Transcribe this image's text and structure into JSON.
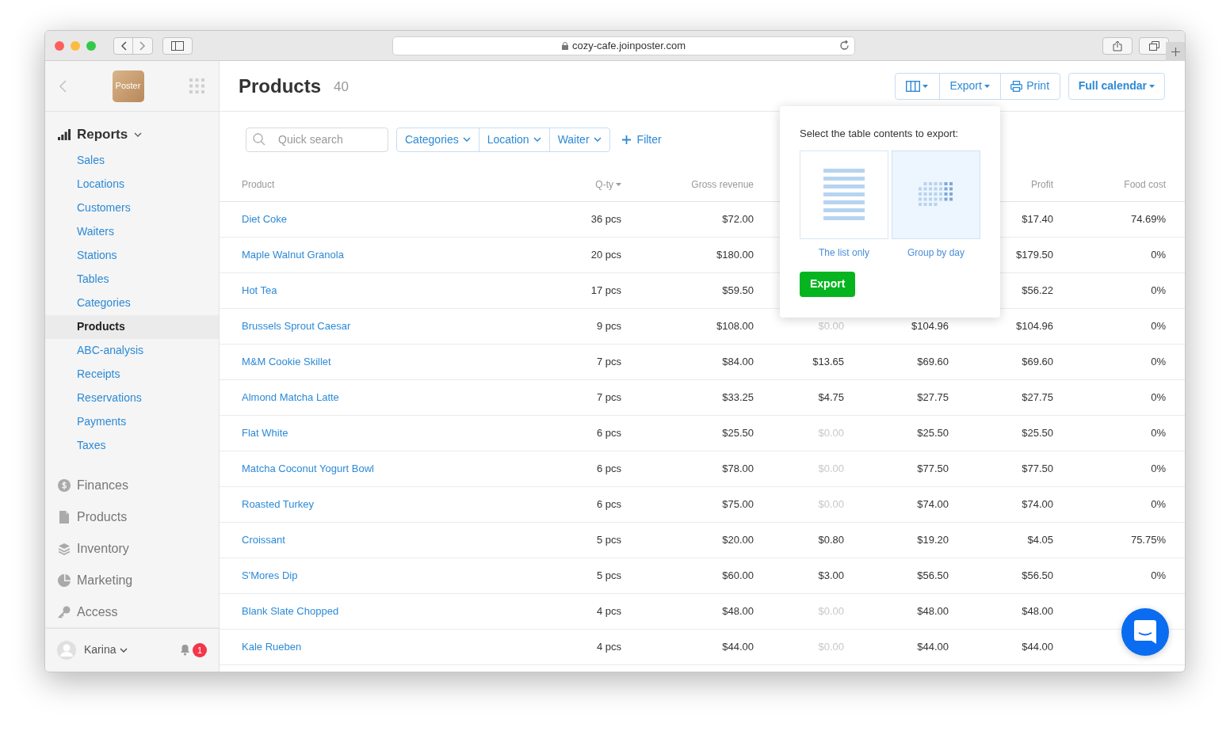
{
  "browser": {
    "url": "cozy-cafe.joinposter.com"
  },
  "sidebar": {
    "logo": "Poster",
    "reports": {
      "label": "Reports",
      "expanded": true,
      "items": [
        {
          "label": "Sales",
          "selected": false
        },
        {
          "label": "Locations",
          "selected": false
        },
        {
          "label": "Customers",
          "selected": false
        },
        {
          "label": "Waiters",
          "selected": false
        },
        {
          "label": "Stations",
          "selected": false
        },
        {
          "label": "Tables",
          "selected": false
        },
        {
          "label": "Categories",
          "selected": false
        },
        {
          "label": "Products",
          "selected": true
        },
        {
          "label": "ABC-analysis",
          "selected": false
        },
        {
          "label": "Receipts",
          "selected": false
        },
        {
          "label": "Reservations",
          "selected": false
        },
        {
          "label": "Payments",
          "selected": false
        },
        {
          "label": "Taxes",
          "selected": false
        }
      ]
    },
    "sections": [
      {
        "label": "Finances",
        "kind": "finances"
      },
      {
        "label": "Products",
        "kind": "products"
      },
      {
        "label": "Inventory",
        "kind": "inventory"
      },
      {
        "label": "Marketing",
        "kind": "marketing"
      },
      {
        "label": "Access",
        "kind": "access"
      }
    ],
    "user": {
      "name": "Karina",
      "notifications": "1"
    }
  },
  "header": {
    "title": "Products",
    "count": "40",
    "export": "Export",
    "print": "Print",
    "calendar": "Full calendar"
  },
  "filters": {
    "search": {
      "placeholder": "Quick search"
    },
    "dropdowns": [
      "Categories",
      "Location",
      "Waiter"
    ],
    "add": "Filter"
  },
  "table": {
    "columns": [
      {
        "label": "Product",
        "sorted": false
      },
      {
        "label": "Q-ty",
        "sorted": true
      },
      {
        "label": "Gross revenue",
        "sorted": false
      },
      null,
      null,
      {
        "label": "Profit",
        "sorted": false
      },
      {
        "label": "Food cost",
        "sorted": false
      }
    ],
    "rows": [
      {
        "cells": [
          "Diet Coke",
          "36 pcs",
          "$72.00",
          null,
          null,
          "$17.40",
          "74.69%"
        ]
      },
      {
        "cells": [
          "Maple Walnut Granola",
          "20 pcs",
          "$180.00",
          null,
          null,
          "$179.50",
          "0%"
        ]
      },
      {
        "cells": [
          "Hot Tea",
          "17 pcs",
          "$59.50",
          null,
          null,
          "$56.22",
          "0%"
        ]
      },
      {
        "cells": [
          "Brussels Sprout Caesar",
          "9 pcs",
          "$108.00",
          "$0.00",
          "$104.96",
          "$104.96",
          "0%"
        ],
        "discount_muted": true
      },
      {
        "cells": [
          "M&M Cookie Skillet",
          "7 pcs",
          "$84.00",
          "$13.65",
          "$69.60",
          "$69.60",
          "0%"
        ],
        "discount_muted": false
      },
      {
        "cells": [
          "Almond Matcha Latte",
          "7 pcs",
          "$33.25",
          "$4.75",
          "$27.75",
          "$27.75",
          "0%"
        ],
        "discount_muted": false
      },
      {
        "cells": [
          "Flat White",
          "6 pcs",
          "$25.50",
          "$0.00",
          "$25.50",
          "$25.50",
          "0%"
        ],
        "discount_muted": true
      },
      {
        "cells": [
          "Matcha Coconut Yogurt Bowl",
          "6 pcs",
          "$78.00",
          "$0.00",
          "$77.50",
          "$77.50",
          "0%"
        ],
        "discount_muted": true
      },
      {
        "cells": [
          "Roasted Turkey",
          "6 pcs",
          "$75.00",
          "$0.00",
          "$74.00",
          "$74.00",
          "0%"
        ],
        "discount_muted": true
      },
      {
        "cells": [
          "Croissant",
          "5 pcs",
          "$20.00",
          "$0.80",
          "$19.20",
          "$4.05",
          "75.75%"
        ],
        "discount_muted": false
      },
      {
        "cells": [
          "S'Mores Dip",
          "5 pcs",
          "$60.00",
          "$3.00",
          "$56.50",
          "$56.50",
          "0%"
        ],
        "discount_muted": false
      },
      {
        "cells": [
          "Blank Slate Chopped",
          "4 pcs",
          "$48.00",
          "$0.00",
          "$48.00",
          "$48.00",
          null
        ],
        "discount_muted": true
      },
      {
        "cells": [
          "Kale Rueben",
          "4 pcs",
          "$44.00",
          "$0.00",
          "$44.00",
          "$44.00",
          null
        ],
        "discount_muted": true
      }
    ]
  },
  "export_popover": {
    "prompt": "Select the table contents to export:",
    "options": [
      {
        "label": "The list only",
        "kind": "list",
        "selected": false
      },
      {
        "label": "Group by day",
        "kind": "grid",
        "selected": true
      }
    ],
    "button": "Export"
  }
}
